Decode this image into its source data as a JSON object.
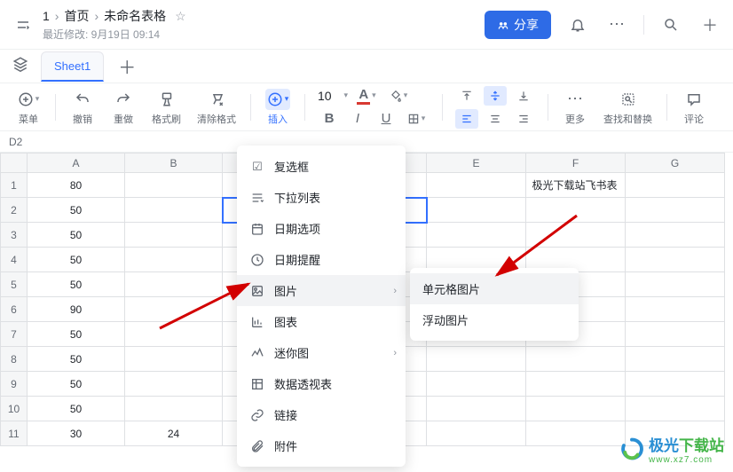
{
  "header": {
    "doc_number": "1",
    "home": "首页",
    "title": "未命名表格",
    "modified": "最近修改: 9月19日 09:14",
    "share": "分享"
  },
  "tabs": {
    "sheet1": "Sheet1"
  },
  "toolbar": {
    "menu": "菜单",
    "undo": "撤销",
    "redo": "重做",
    "format_paint": "格式刷",
    "clear_format": "清除格式",
    "insert": "插入",
    "font_size": "10",
    "more": "更多",
    "find_replace": "查找和替换",
    "comment": "评论"
  },
  "cell_ref": "D2",
  "columns": [
    "A",
    "B",
    "E",
    "F",
    "G"
  ],
  "rows": [
    {
      "n": "1",
      "a": "80"
    },
    {
      "n": "2",
      "a": "50"
    },
    {
      "n": "3",
      "a": "50"
    },
    {
      "n": "4",
      "a": "50"
    },
    {
      "n": "5",
      "a": "50"
    },
    {
      "n": "6",
      "a": "90"
    },
    {
      "n": "7",
      "a": "50"
    },
    {
      "n": "8",
      "a": "50"
    },
    {
      "n": "9",
      "a": "50"
    },
    {
      "n": "10",
      "a": "50"
    },
    {
      "n": "11",
      "a": "30"
    }
  ],
  "row11_b": "24",
  "annotation_text": "极光下载站飞书表",
  "insert_menu": {
    "checkbox": "复选框",
    "dropdown": "下拉列表",
    "date_option": "日期选项",
    "date_remind": "日期提醒",
    "image": "图片",
    "chart": "图表",
    "sparkline": "迷你图",
    "pivot": "数据透视表",
    "link": "链接",
    "attachment": "附件"
  },
  "image_submenu": {
    "cell_image": "单元格图片",
    "float_image": "浮动图片"
  },
  "watermark": {
    "name": "极光下载站",
    "url": "www.xz7.com"
  }
}
